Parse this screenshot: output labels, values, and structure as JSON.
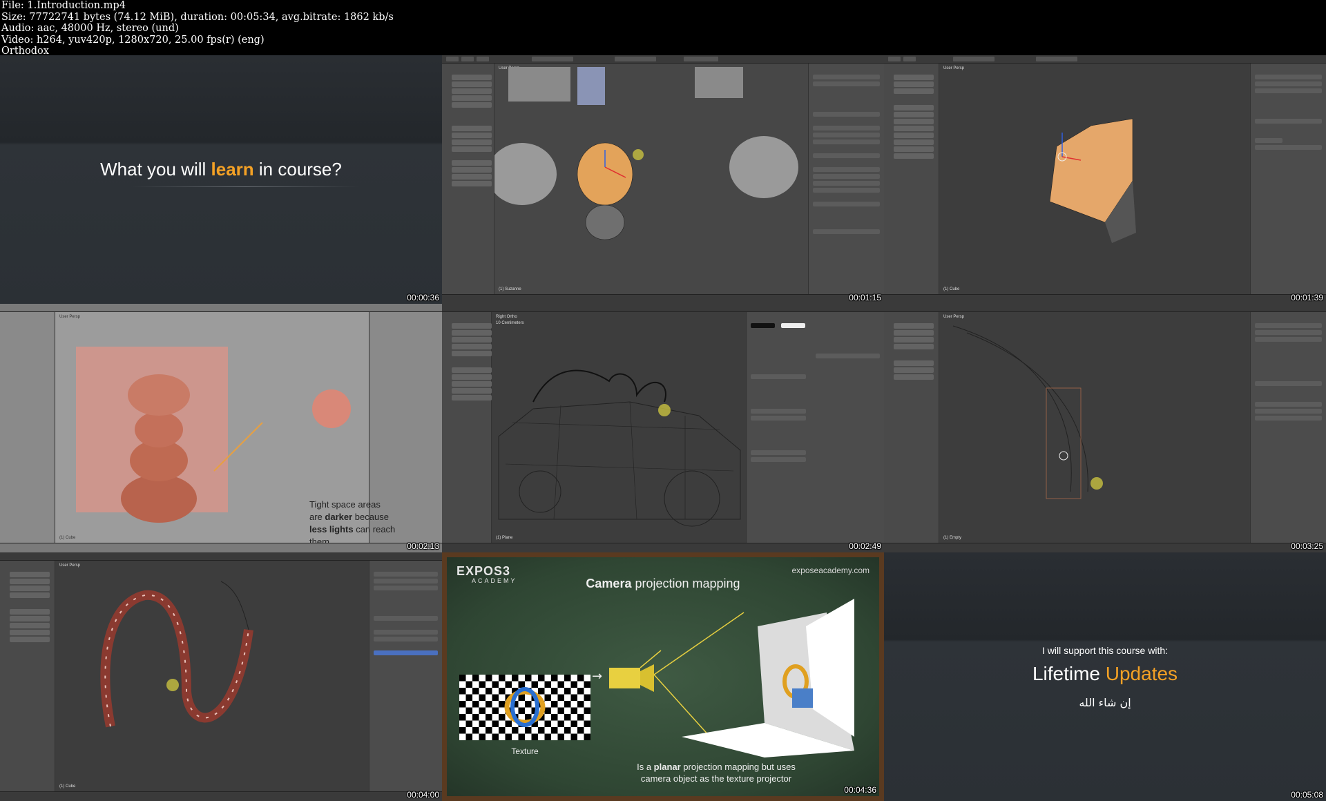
{
  "header": {
    "lines": [
      "File: 1.Introduction.mp4",
      "Size: 77722741 bytes (74.12 MiB), duration: 00:05:34, avg.bitrate: 1862 kb/s",
      "Audio: aac, 48000 Hz, stereo (und)",
      "Video: h264, yuv420p, 1280x720, 25.00 fps(r) (eng)",
      "Orthodox"
    ]
  },
  "tiles": [
    {
      "timestamp": "00:00:36",
      "title_pre": "What you will ",
      "title_accent": "learn",
      "title_post": " in course?"
    },
    {
      "timestamp": "00:01:15",
      "viewport_label": "User Persp",
      "object_label": "(1) Suzanne"
    },
    {
      "timestamp": "00:01:39",
      "viewport_label": "User Persp",
      "object_label": "(1) Cube"
    },
    {
      "timestamp": "00:02:13",
      "viewport_label": "User Persp",
      "object_label": "(1) Cube",
      "overlay": [
        "Tight space areas",
        "are ",
        "darker",
        " because",
        "less lights",
        " can reach",
        "them"
      ]
    },
    {
      "timestamp": "00:02:49",
      "viewport_label": "Right Ortho",
      "sub_label": "10 Centimeters",
      "object_label": "(1) Plane"
    },
    {
      "timestamp": "00:03:25",
      "viewport_label": "User Persp",
      "object_label": "(1) Empty"
    },
    {
      "timestamp": "00:04:00",
      "viewport_label": "User Persp",
      "object_label": "(1) Cube"
    },
    {
      "timestamp": "00:04:36",
      "logo": "EXPOS3",
      "logo_sub": "ACADEMY",
      "site": "exposeacademy.com",
      "title_bold": "Camera",
      "title_rest": " projection mapping",
      "caption": "Texture",
      "foot_pre": "Is a ",
      "foot_bold": "planar",
      "foot_rest": " projection mapping but uses",
      "foot_line2": "camera object as the texture projector"
    },
    {
      "timestamp": "00:05:08",
      "line1": "I will support this course with:",
      "title_white": "Lifetime ",
      "title_accent": "Updates",
      "arabic": "إن شاء الله"
    }
  ],
  "colors": {
    "accent": "#f4a125",
    "blender_bg": "#3d3d3d",
    "selection": "#f39c3d"
  }
}
